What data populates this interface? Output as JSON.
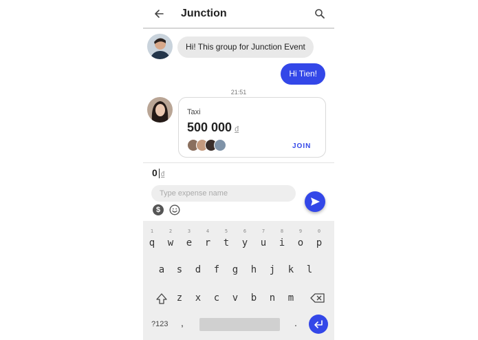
{
  "header": {
    "title": "Junction",
    "back_icon": "arrow-left-icon",
    "search_icon": "search-icon"
  },
  "messages": [
    {
      "text": "Hi! This group for Junction Event",
      "direction": "incoming"
    },
    {
      "text": "Hi Tien!",
      "direction": "outgoing"
    }
  ],
  "timestamp": "21:51",
  "expense_card": {
    "label": "Taxi",
    "amount": "500 000",
    "currency": "đ",
    "participants_count": 4,
    "join_label": "JOIN"
  },
  "composer": {
    "amount_value": "0",
    "currency": "đ",
    "expense_placeholder": "Type expense name",
    "expense_value": ""
  },
  "keyboard": {
    "row1_hints": [
      "1",
      "2",
      "3",
      "4",
      "5",
      "6",
      "7",
      "8",
      "9",
      "0"
    ],
    "row1": [
      "q",
      "w",
      "e",
      "r",
      "t",
      "y",
      "u",
      "i",
      "o",
      "p"
    ],
    "row2": [
      "a",
      "s",
      "d",
      "f",
      "g",
      "h",
      "j",
      "k",
      "l"
    ],
    "row3": [
      "z",
      "x",
      "c",
      "v",
      "b",
      "n",
      "m"
    ],
    "symbols_label": "?123",
    "comma": ",",
    "period": "."
  },
  "colors": {
    "accent": "#3347e8",
    "bubble_incoming": "#e9e9e9",
    "keyboard_bg": "#eeeeee"
  }
}
